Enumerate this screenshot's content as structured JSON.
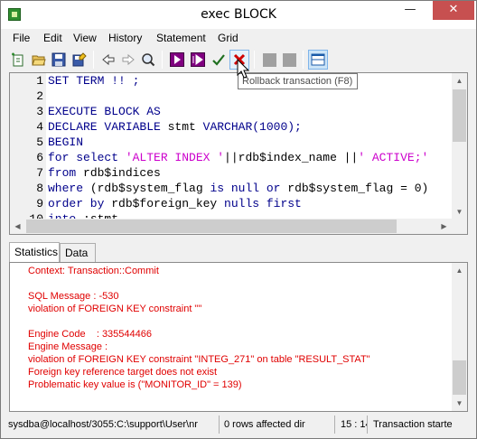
{
  "window": {
    "title": "exec BLOCK",
    "minimize_glyph": "—",
    "maximize_glyph": "☐",
    "close_glyph": "✕"
  },
  "menu": {
    "items": [
      "File",
      "Edit",
      "View",
      "History",
      "Statement",
      "Grid"
    ]
  },
  "toolbar": {
    "buttons": [
      "new-statement-icon",
      "open-file-icon",
      "save-icon",
      "save-as-icon",
      "back-icon",
      "forward-icon",
      "find-icon",
      "execute-icon",
      "execute-step-icon",
      "commit-icon",
      "rollback-icon",
      "disabled-button-1",
      "disabled-button-2",
      "layout-toggle-icon"
    ],
    "tooltip": "Rollback transaction (F8)",
    "colors": {
      "execute": "#800080",
      "commit": "#1f6f1f",
      "rollback": "#d00000"
    }
  },
  "editor": {
    "lines": [
      {
        "num": "1",
        "parts": [
          {
            "t": "kw",
            "s": "SET TERM !! ;"
          }
        ]
      },
      {
        "num": "2",
        "parts": []
      },
      {
        "num": "3",
        "parts": [
          {
            "t": "kw",
            "s": "EXECUTE BLOCK AS"
          }
        ]
      },
      {
        "num": "4",
        "parts": [
          {
            "t": "kw",
            "s": "DECLARE VARIABLE "
          },
          {
            "t": "plain",
            "s": "stmt "
          },
          {
            "t": "kw",
            "s": "VARCHAR(1000);"
          }
        ]
      },
      {
        "num": "5",
        "parts": [
          {
            "t": "kw",
            "s": "BEGIN"
          }
        ]
      },
      {
        "num": "6",
        "parts": [
          {
            "t": "kw",
            "s": "for select "
          },
          {
            "t": "str",
            "s": "'ALTER INDEX '"
          },
          {
            "t": "plain",
            "s": "||rdb$index_name ||"
          },
          {
            "t": "str",
            "s": "' ACTIVE;'"
          }
        ]
      },
      {
        "num": "7",
        "parts": [
          {
            "t": "kw",
            "s": "from "
          },
          {
            "t": "plain",
            "s": "rdb$indices"
          }
        ]
      },
      {
        "num": "8",
        "parts": [
          {
            "t": "kw",
            "s": "where "
          },
          {
            "t": "plain",
            "s": "(rdb$system_flag "
          },
          {
            "t": "kw",
            "s": "is null or "
          },
          {
            "t": "plain",
            "s": "rdb$system_flag = 0)"
          }
        ]
      },
      {
        "num": "9",
        "parts": [
          {
            "t": "kw",
            "s": "order by "
          },
          {
            "t": "plain",
            "s": "rdb$foreign_key "
          },
          {
            "t": "kw",
            "s": "nulls first"
          }
        ]
      },
      {
        "num": "10",
        "parts": [
          {
            "t": "kw",
            "s": "into "
          },
          {
            "t": "plain",
            "s": ":stmt"
          }
        ]
      }
    ]
  },
  "tabs": [
    "Statistics",
    "Data"
  ],
  "output": {
    "lines": [
      "Context: Transaction::Commit",
      "",
      "SQL Message : -530",
      "violation of FOREIGN KEY constraint \"\"",
      "",
      "Engine Code    : 335544466",
      "Engine Message :",
      "violation of FOREIGN KEY constraint \"INTEG_271\" on table \"RESULT_STAT\"",
      "Foreign key reference target does not exist",
      "Problematic key value is (\"MONITOR_ID\" = 139)"
    ]
  },
  "status": {
    "connection": "sysdba@localhost/3055:C:\\support\\User\\nr",
    "rows": "0 rows affected dir",
    "cursor": "15 : 14",
    "transaction": "Transaction starte"
  }
}
